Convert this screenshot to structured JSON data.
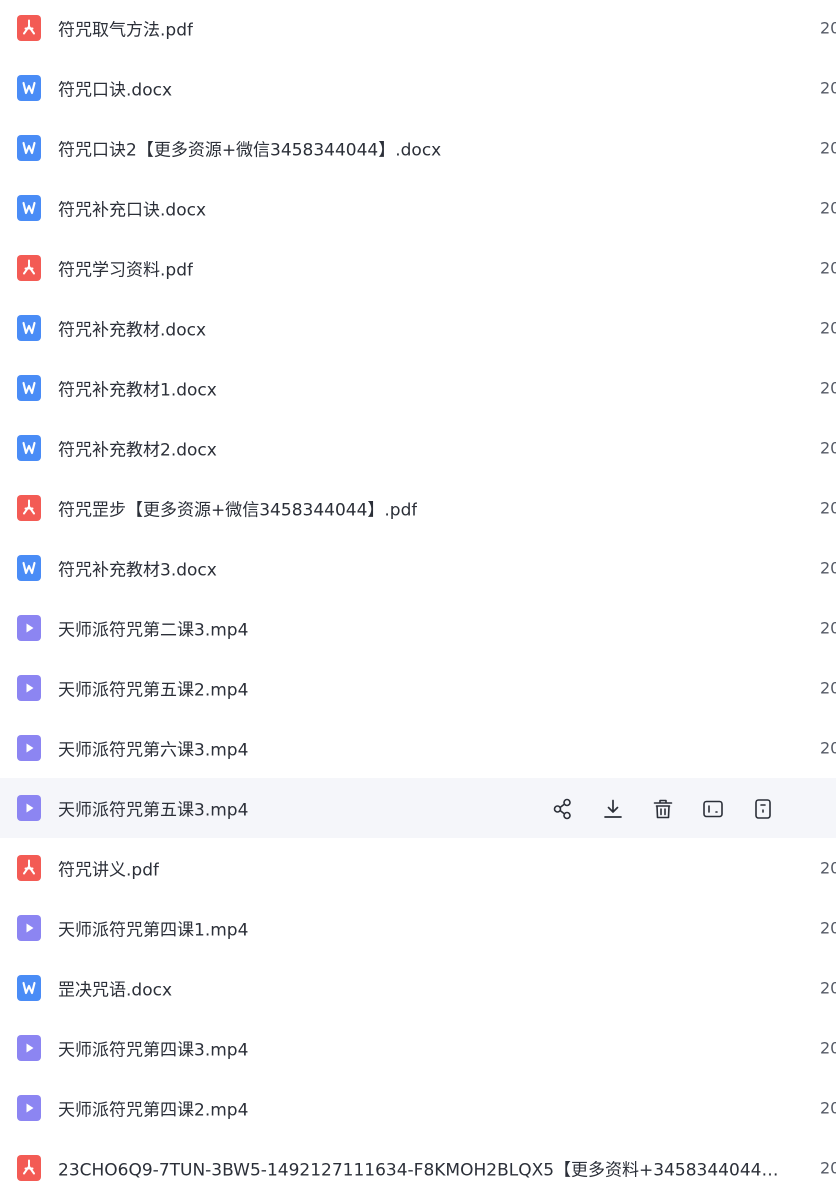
{
  "files": [
    {
      "name": "符咒取气方法.pdf",
      "type": "pdf",
      "icon": "pdf-file-icon",
      "date": "20"
    },
    {
      "name": "符咒口诀.docx",
      "type": "docx",
      "icon": "word-file-icon",
      "date": "20"
    },
    {
      "name": "符咒口诀2【更多资源+微信3458344044】.docx",
      "type": "docx",
      "icon": "word-file-icon",
      "date": "20"
    },
    {
      "name": "符咒补充口诀.docx",
      "type": "docx",
      "icon": "word-file-icon",
      "date": "20"
    },
    {
      "name": "符咒学习资料.pdf",
      "type": "pdf",
      "icon": "pdf-file-icon",
      "date": "20"
    },
    {
      "name": "符咒补充教材.docx",
      "type": "docx",
      "icon": "word-file-icon",
      "date": "20"
    },
    {
      "name": "符咒补充教材1.docx",
      "type": "docx",
      "icon": "word-file-icon",
      "date": "20"
    },
    {
      "name": "符咒补充教材2.docx",
      "type": "docx",
      "icon": "word-file-icon",
      "date": "20"
    },
    {
      "name": "符咒罡步【更多资源+微信3458344044】.pdf",
      "type": "pdf",
      "icon": "pdf-file-icon",
      "date": "20"
    },
    {
      "name": "符咒补充教材3.docx",
      "type": "docx",
      "icon": "word-file-icon",
      "date": "20"
    },
    {
      "name": "天师派符咒第二课3.mp4",
      "type": "mp4",
      "icon": "video-file-icon",
      "date": "20"
    },
    {
      "name": "天师派符咒第五课2.mp4",
      "type": "mp4",
      "icon": "video-file-icon",
      "date": "20"
    },
    {
      "name": "天师派符咒第六课3.mp4",
      "type": "mp4",
      "icon": "video-file-icon",
      "date": "20"
    },
    {
      "name": "天师派符咒第五课3.mp4",
      "type": "mp4",
      "icon": "video-file-icon",
      "date": "",
      "hovered": true
    },
    {
      "name": "符咒讲义.pdf",
      "type": "pdf",
      "icon": "pdf-file-icon",
      "date": "20"
    },
    {
      "name": "天师派符咒第四课1.mp4",
      "type": "mp4",
      "icon": "video-file-icon",
      "date": "20"
    },
    {
      "name": "罡决咒语.docx",
      "type": "docx",
      "icon": "word-file-icon",
      "date": "20"
    },
    {
      "name": "天师派符咒第四课3.mp4",
      "type": "mp4",
      "icon": "video-file-icon",
      "date": "20"
    },
    {
      "name": "天师派符咒第四课2.mp4",
      "type": "mp4",
      "icon": "video-file-icon",
      "date": "20"
    },
    {
      "name": "23CHO6Q9-7TUN-3BW5-1492127111634-F8KMOH2BLQX5【更多资料+3458344044…",
      "type": "pdf",
      "icon": "pdf-file-icon",
      "date": "20"
    }
  ],
  "row_actions": [
    {
      "name": "share-button",
      "icon": "share-icon"
    },
    {
      "name": "download-button",
      "icon": "download-icon"
    },
    {
      "name": "delete-button",
      "icon": "trash-icon"
    },
    {
      "name": "rename-button",
      "icon": "rename-icon"
    },
    {
      "name": "more-button",
      "icon": "document-info-icon"
    }
  ],
  "colors": {
    "pdf": "#f35b55",
    "docx": "#4a8cf6",
    "mp4": "#8c85f2",
    "hover_row": "#f5f6fa",
    "action_icon": "#2b2f38"
  }
}
